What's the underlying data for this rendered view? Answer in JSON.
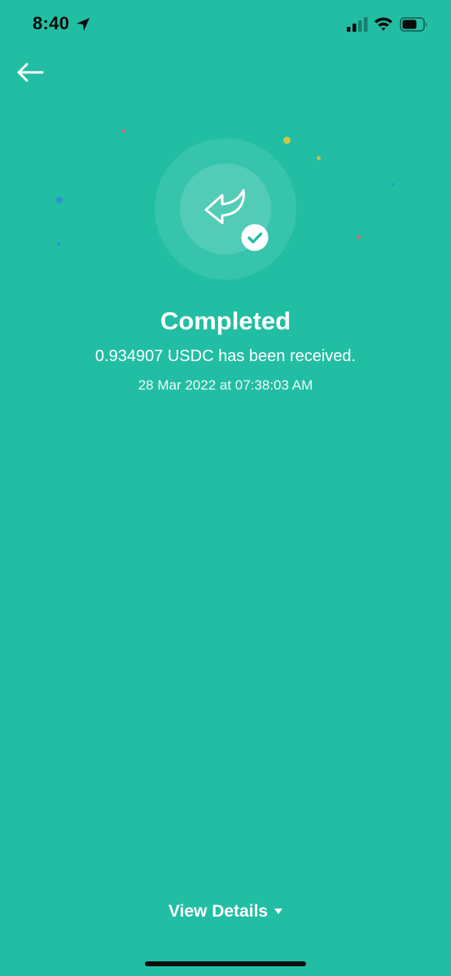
{
  "status_bar": {
    "time": "8:40"
  },
  "result": {
    "title": "Completed",
    "message": "0.934907 USDC has been received.",
    "timestamp": "28 Mar 2022 at 07:38:03 AM"
  },
  "footer": {
    "view_details_label": "View Details"
  },
  "icons": {
    "back": "arrow-left-icon",
    "transaction": "reply-arrow-icon",
    "status": "check-circle-icon",
    "expand": "caret-down-icon"
  },
  "colors": {
    "background": "#21bea3",
    "text": "#ffffff",
    "status_bar_text": "#0b0b0b"
  }
}
